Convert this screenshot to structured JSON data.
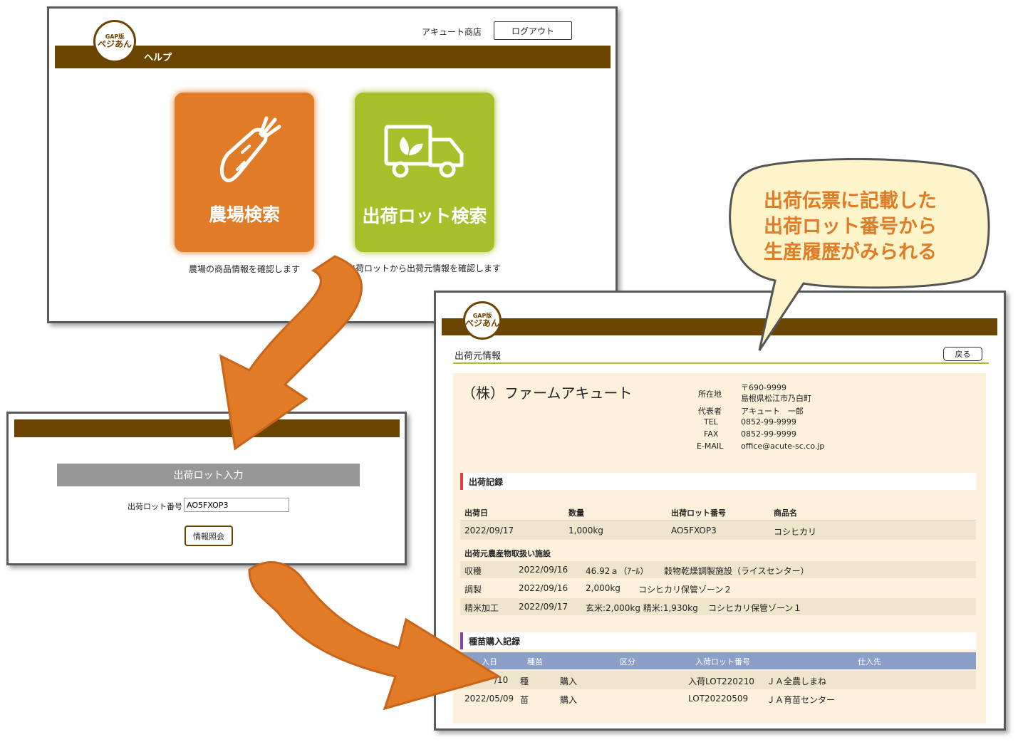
{
  "help_window": {
    "logo": {
      "gap": "GAP版",
      "name": "ベジあん"
    },
    "store_name": "アキュート商店",
    "logout_label": "ログアウト",
    "bar_title": "ヘルプ",
    "farm_tile": {
      "label": "農場検索",
      "caption": "農場の商品情報を確認します",
      "icon": "carrot-icon",
      "color": "#e07b28"
    },
    "lot_tile": {
      "label": "出荷ロット検索",
      "caption": "出荷ロットから出荷元情報を確認します",
      "icon": "truck-icon",
      "color": "#a6bf2a"
    }
  },
  "input_window": {
    "panel_title": "出荷ロット入力",
    "field_label": "出荷ロット番号",
    "field_value": "AO5FXOP3",
    "submit_label": "情報照会"
  },
  "callout": {
    "lines": [
      "出荷伝票に記載した",
      "出荷ロット番号から",
      "生産履歴がみられる"
    ]
  },
  "detail_window": {
    "logo": {
      "gap": "GAP版",
      "name": "ベジあん"
    },
    "page_title": "出荷元情報",
    "back_label": "戻る",
    "company_name": "（株）ファームアキュート",
    "info": [
      {
        "label": "所在地",
        "value": "〒690-9999"
      },
      {
        "label": "",
        "value": "島根県松江市乃白町"
      },
      {
        "label": "代表者",
        "value": "アキュート　一郎"
      },
      {
        "label": "TEL",
        "value": "0852-99-9999"
      },
      {
        "label": "FAX",
        "value": "0852-99-9999"
      },
      {
        "label": "E-MAIL",
        "value": "office@acute-sc.co.jp"
      }
    ],
    "shipping": {
      "title": "出荷記録",
      "headers": [
        "出荷日",
        "数量",
        "出荷ロット番号",
        "商品名"
      ],
      "row": [
        "2022/09/17",
        "1,000kg",
        "AO5FXOP3",
        "コシヒカリ"
      ],
      "facility_title": "出荷元農産物取扱い施設",
      "facility_rows": [
        [
          "収穫",
          "2022/09/16",
          "46.92ａ（ｱｰﾙ）",
          "穀物乾燥調製施設（ライスセンター）"
        ],
        [
          "調製",
          "2022/09/16",
          "2,000kg",
          "コシヒカリ保管ゾーン２"
        ],
        [
          "精米加工",
          "2022/09/17",
          "玄米:2,000kg 精米:1,930kg",
          "コシヒカリ保管ゾーン１"
        ]
      ]
    },
    "seed": {
      "title": "種苗購入記録",
      "headers": [
        "入日",
        "種苗",
        "区分",
        "入荷ロット番号",
        "仕入先"
      ],
      "rows": [
        [
          "/10",
          "種",
          "購入",
          "入荷LOT220210",
          "ＪＡ全農しまね"
        ],
        [
          "2022/05/09",
          "苗",
          "購入",
          "LOT20220509",
          "ＪＡ育苗センター"
        ]
      ]
    },
    "accent_colors": {
      "shipping": "#e03c4a",
      "seed": "#7b4aa0",
      "table_header": "#8aa0c8"
    }
  }
}
